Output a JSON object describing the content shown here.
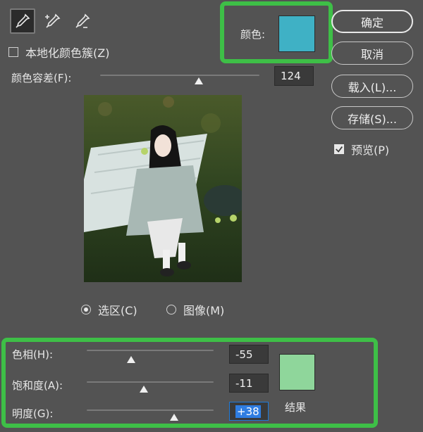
{
  "toolbar": {
    "tools": [
      {
        "icon": "eyedropper-icon",
        "active": true
      },
      {
        "icon": "eyedropper-plus-icon",
        "active": false
      },
      {
        "icon": "eyedropper-minus-icon",
        "active": false
      }
    ]
  },
  "localized_clusters": {
    "label": "本地化颜色簇(Z)",
    "checked": false
  },
  "color": {
    "label": "颜色:",
    "swatch": "#3fb1c5"
  },
  "fuzziness": {
    "label": "颜色容差(F):",
    "value": "124",
    "fraction": 0.62
  },
  "buttons": {
    "ok": "确定",
    "cancel": "取消",
    "load": "载入(L)...",
    "save": "存储(S)..."
  },
  "preview_toggle": {
    "label": "预览(P)",
    "checked": true
  },
  "view_mode": {
    "selection": "选区(C)",
    "image": "图像(M)",
    "selected": "selection"
  },
  "adjust": {
    "hue": {
      "label": "色相(H):",
      "value": "-55",
      "fraction": 0.35
    },
    "saturation": {
      "label": "饱和度(A):",
      "value": "-11",
      "fraction": 0.45
    },
    "lightness": {
      "label": "明度(G):",
      "value": "+38",
      "fraction": 0.69
    }
  },
  "result": {
    "label": "结果",
    "swatch": "#8fd69b"
  },
  "colors": {
    "highlight": "#3ebf47",
    "background": "#535353"
  }
}
